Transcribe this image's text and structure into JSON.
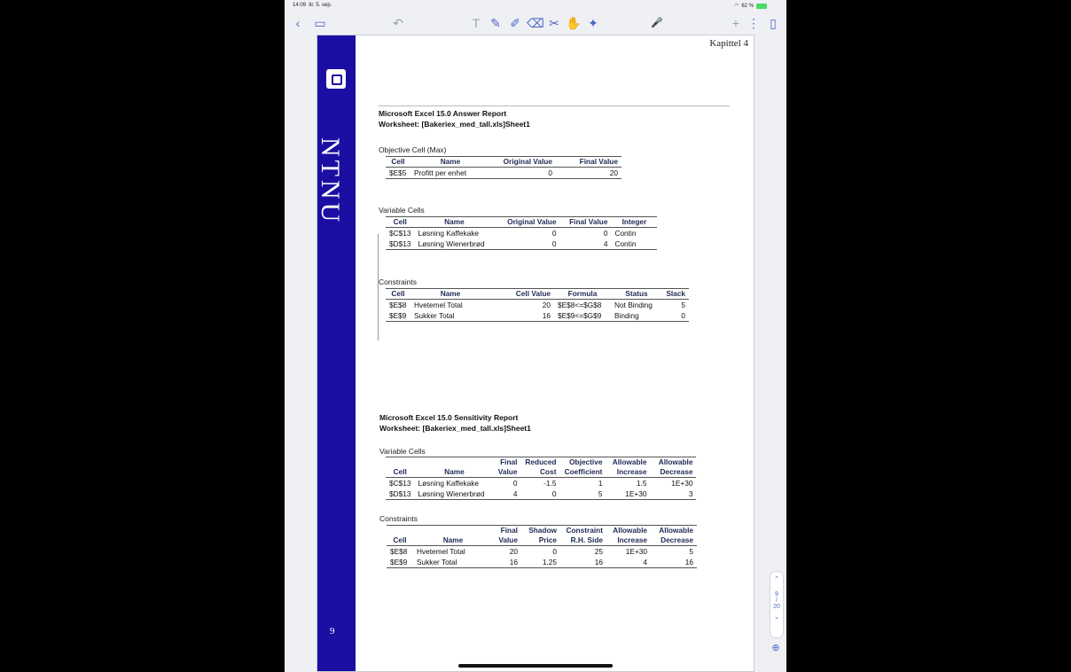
{
  "status": {
    "time": "14:09",
    "date": "tir. 5. sep.",
    "battery": "62 %"
  },
  "toolbar": {
    "back": "‹",
    "pages": "▭",
    "undo": "↶",
    "text": "T",
    "pen": "✎",
    "highlighter": "✐",
    "eraser": "⌫",
    "lasso": "✂",
    "hand": "✋",
    "mic": "🎤",
    "add": "+",
    "more": "⋮",
    "sidebar": "▯"
  },
  "page": {
    "chapter": "Kapittel 4",
    "logo_text": "NTNU",
    "page_number": "9"
  },
  "answer_report": {
    "title": "Microsoft Excel 15.0 Answer Report",
    "worksheet": "Worksheet: [Bakeriex_med_tall.xls]Sheet1",
    "objective_label": "Objective Cell (Max)",
    "objective_headers": [
      "Cell",
      "Name",
      "Original Value",
      "Final Value"
    ],
    "objective_rows": [
      [
        "$E$5",
        "Profitt per enhet",
        "0",
        "20"
      ]
    ],
    "variable_label": "Variable Cells",
    "variable_headers": [
      "Cell",
      "Name",
      "Original Value",
      "Final Value",
      "Integer"
    ],
    "variable_rows": [
      [
        "$C$13",
        "Løsning Kaffekake",
        "0",
        "0",
        "Contin"
      ],
      [
        "$D$13",
        "Løsning Wienerbrød",
        "0",
        "4",
        "Contin"
      ]
    ],
    "constraints_label": "Constraints",
    "constraint_headers": [
      "Cell",
      "Name",
      "Cell Value",
      "Formula",
      "Status",
      "Slack"
    ],
    "constraint_rows": [
      [
        "$E$8",
        "Hvetemel Total",
        "20",
        "$E$8<=$G$8",
        "Not Binding",
        "5"
      ],
      [
        "$E$9",
        "Sukker Total",
        "16",
        "$E$9<=$G$9",
        "Binding",
        "0"
      ]
    ]
  },
  "sensitivity_report": {
    "title": "Microsoft Excel 15.0 Sensitivity Report",
    "worksheet": "Worksheet: [Bakeriex_med_tall.xls]Sheet1",
    "variable_label": "Variable Cells",
    "variable_headers_top": [
      "",
      "",
      "Final",
      "Reduced",
      "Objective",
      "Allowable",
      "Allowable"
    ],
    "variable_headers": [
      "Cell",
      "Name",
      "Value",
      "Cost",
      "Coefficient",
      "Increase",
      "Decrease"
    ],
    "variable_rows": [
      [
        "$C$13",
        "Løsning Kaffekake",
        "0",
        "-1.5",
        "1",
        "1.5",
        "1E+30"
      ],
      [
        "$D$13",
        "Løsning Wienerbrød",
        "4",
        "0",
        "5",
        "1E+30",
        "3"
      ]
    ],
    "constraints_label": "Constraints",
    "constraint_headers_top": [
      "",
      "",
      "Final",
      "Shadow",
      "Constraint",
      "Allowable",
      "Allowable"
    ],
    "constraint_headers": [
      "Cell",
      "Name",
      "Value",
      "Price",
      "R.H. Side",
      "Increase",
      "Decrease"
    ],
    "constraint_rows": [
      [
        "$E$8",
        "Hvetemel Total",
        "20",
        "0",
        "25",
        "1E+30",
        "5"
      ],
      [
        "$E$9",
        "Sukker Total",
        "16",
        "1.25",
        "16",
        "4",
        "16"
      ]
    ]
  },
  "scroller": {
    "up": "⌃",
    "current": "9",
    "total": "20",
    "down": "⌄",
    "zoom": "⊕"
  }
}
